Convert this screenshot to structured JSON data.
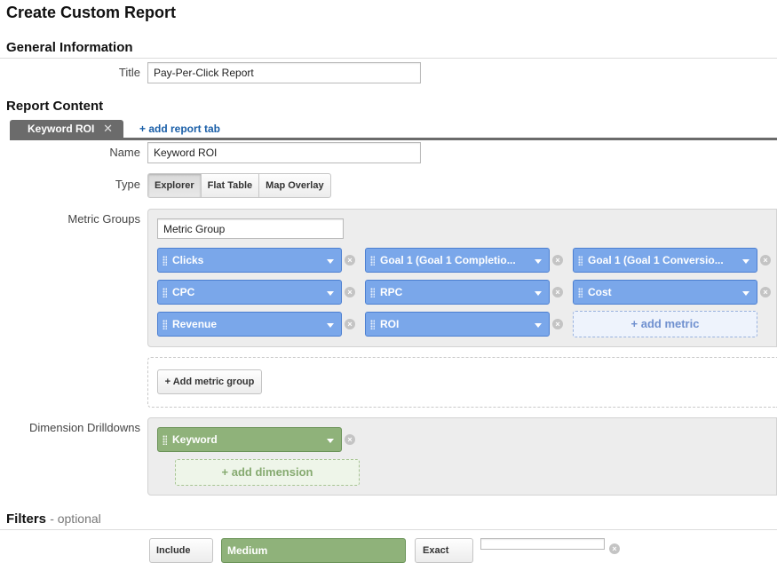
{
  "page": {
    "title": "Create Custom Report"
  },
  "general": {
    "heading": "General Information",
    "title_label": "Title",
    "title_value": "Pay-Per-Click Report"
  },
  "report_content": {
    "heading": "Report Content",
    "tabs": [
      {
        "label": "Keyword ROI",
        "close": "✕"
      }
    ],
    "add_tab_label": "+ add report tab",
    "name_label": "Name",
    "name_value": "Keyword ROI",
    "type_label": "Type",
    "types": [
      {
        "label": "Explorer",
        "active": true
      },
      {
        "label": "Flat Table",
        "active": false
      },
      {
        "label": "Map Overlay",
        "active": false
      }
    ],
    "metric_groups_label": "Metric Groups",
    "metric_group_name": "Metric Group",
    "metrics": [
      {
        "label": "Clicks"
      },
      {
        "label": "Goal 1 (Goal 1 Completio..."
      },
      {
        "label": "Goal 1 (Goal 1 Conversio..."
      },
      {
        "label": "CPC"
      },
      {
        "label": "RPC"
      },
      {
        "label": "Cost"
      },
      {
        "label": "Revenue"
      },
      {
        "label": "ROI"
      }
    ],
    "add_metric_label": "+ add metric",
    "add_metric_group_label": "+ Add metric group",
    "dimension_label": "Dimension Drilldowns",
    "dimensions": [
      {
        "label": "Keyword"
      }
    ],
    "add_dimension_label": "+ add dimension"
  },
  "filters": {
    "heading": "Filters",
    "optional": "- optional",
    "include_label": "Include",
    "dimension": "Medium",
    "match": "Exact"
  },
  "icons": {
    "remove": "×"
  },
  "colors": {
    "metric_chip": "#7aa7ea",
    "dimension_chip": "#8fb27a",
    "tab": "#6b6b6b",
    "link": "#1a5fa8"
  }
}
